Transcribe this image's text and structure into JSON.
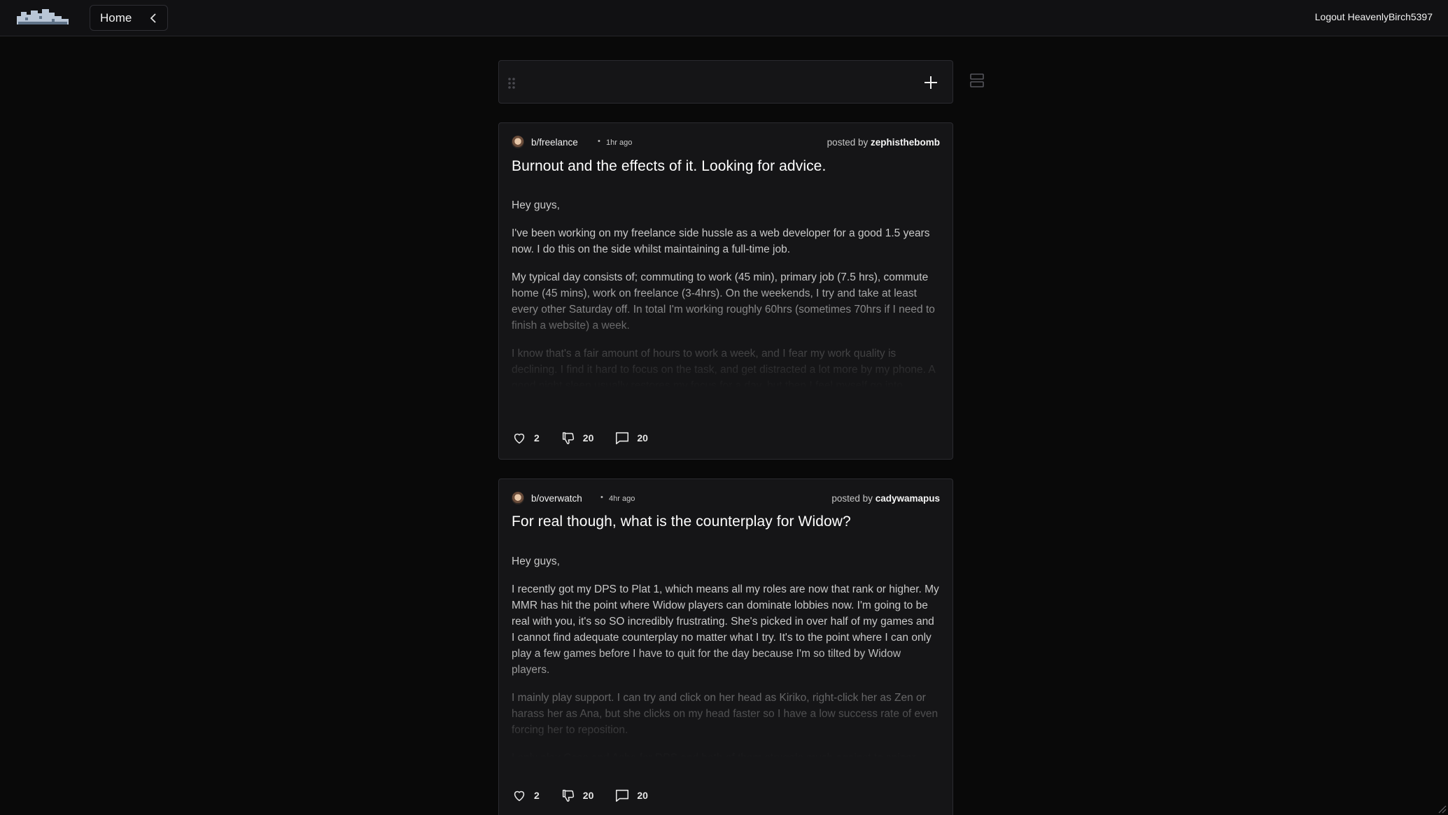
{
  "header": {
    "logo_icon": "cloud-logo-icon",
    "nav_label": "Home",
    "collapse_icon": "chevron-left-icon",
    "logout_label": "Logout",
    "username": "HeavenlyBirch5397"
  },
  "composer": {
    "drag_icon": "drag-handle-icon",
    "add_icon": "plus-icon",
    "layout_icon": "layout-rows-icon"
  },
  "posts": [
    {
      "community": "b/freelance",
      "time": "1hr ago",
      "posted_by_label": "posted by",
      "author": "zephisthebomb",
      "title": "Burnout and the effects of it. Looking for advice.",
      "paragraphs": [
        "Hey guys,",
        "I've been working on my freelance side hussle as a web developer for a good 1.5 years now. I do this on the side whilst maintaining a full-time job.",
        "My typical day consists of; commuting to work (45 min), primary job (7.5 hrs), commute home (45 mins), work on freelance (3-4hrs). On the weekends, I try and take at least every other Saturday off. In total I'm working roughly 60hrs (sometimes 70hrs if I need to finish a website) a week.",
        "I know that's a fair amount of hours to work a week, and I fear my work quality is declining. I find it hard to focus on the task, and get distracted a lot more by my phone. A good night sleep usually restores my focus for a day, but then I feel myself go into another slump."
      ],
      "likes": "2",
      "dislikes": "20",
      "comments": "20"
    },
    {
      "community": "b/overwatch",
      "time": "4hr ago",
      "posted_by_label": "posted by",
      "author": "cadywamapus",
      "title": "For real though, what is the counterplay for Widow?",
      "paragraphs": [
        "Hey guys,",
        "I recently got my DPS to Plat 1, which means all my roles are now that rank or higher. My MMR has hit the point where Widow players can dominate lobbies now. I'm going to be real with you, it's so SO incredibly frustrating. She's picked in over half of my games and I cannot find adequate counterplay no matter what I try. It's to the point where I can only play a few games before I have to quit for the day because I'm so tilted by Widow players.",
        "I mainly play support. I can try and click on her head as Kiriko, right-click her as Zen or harass her as Ana, but she clicks on my head faster so I have a low success rate of even forcing her to reposition.",
        "I only play Cass and Ashe for DPS and both of them struggle much against to sniper."
      ],
      "likes": "2",
      "dislikes": "20",
      "comments": "20"
    }
  ],
  "icons": {
    "like": "heart-icon",
    "dislike": "thumbs-down-icon",
    "comment": "comment-icon"
  }
}
